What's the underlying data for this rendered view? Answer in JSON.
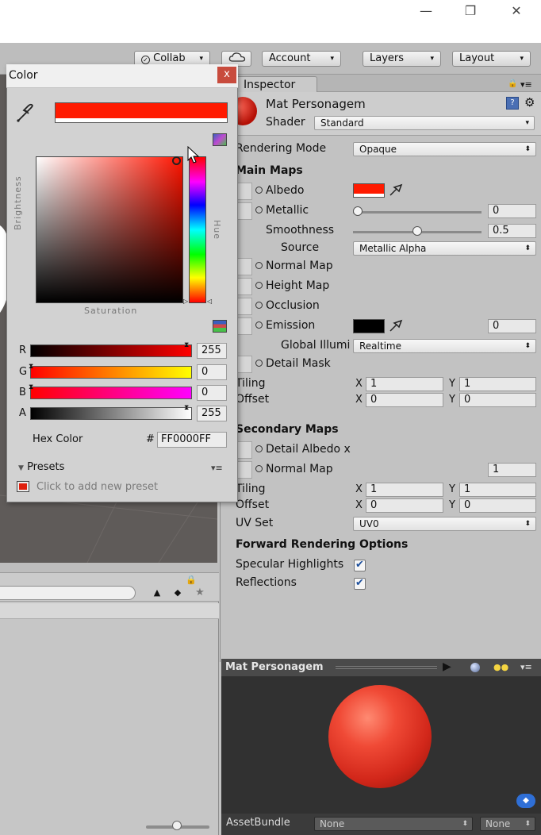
{
  "window": {
    "minimize": "—",
    "restore": "❐",
    "close": "✕"
  },
  "toolbar": {
    "collab": "Collab",
    "account": "Account",
    "layers": "Layers",
    "layout": "Layout",
    "dropdown_arrow": "▾"
  },
  "inspector": {
    "tab": "Inspector",
    "material_name": "Mat Personagem",
    "shader_label": "Shader",
    "shader_value": "Standard",
    "rendering_mode_label": "Rendering Mode",
    "rendering_mode_value": "Opaque",
    "main_maps": "Main Maps",
    "albedo": "Albedo",
    "metallic": "Metallic",
    "metallic_value": "0",
    "metallic_level": 0.0,
    "smoothness": "Smoothness",
    "smoothness_value": "0.5",
    "smoothness_level": 0.5,
    "source": "Source",
    "source_value": "Metallic Alpha",
    "normal_map": "Normal Map",
    "height_map": "Height Map",
    "occlusion": "Occlusion",
    "emission": "Emission",
    "emission_value": "0",
    "global_illum": "Global Illumi",
    "global_illum_value": "Realtime",
    "detail_mask": "Detail Mask",
    "tiling": "Tiling",
    "offset": "Offset",
    "x": "X",
    "y": "Y",
    "tiling_x": "1",
    "tiling_y": "1",
    "offset_x": "0",
    "offset_y": "0",
    "secondary_maps": "Secondary Maps",
    "detail_albedo": "Detail Albedo x",
    "secondary_normal": "Normal Map",
    "secondary_normal_value": "1",
    "tiling2_x": "1",
    "tiling2_y": "1",
    "offset2_x": "0",
    "offset2_y": "0",
    "uv_set": "UV Set",
    "uv_set_value": "UV0",
    "forward_opts": "Forward Rendering Options",
    "specular": "Specular Highlights",
    "reflections": "Reflections",
    "check": "✔",
    "albedo_color": "#ff1a00",
    "emission_color": "#000000"
  },
  "preview": {
    "title": "Mat Personagem",
    "assetbundle": "AssetBundle",
    "bundle_value": "None",
    "variant_value": "None"
  },
  "color_picker": {
    "title": "Color",
    "close": "x",
    "brightness": "Brightness",
    "saturation": "Saturation",
    "hue": "Hue",
    "r_label": "R",
    "r_value": "255",
    "g_label": "G",
    "g_value": "0",
    "b_label": "B",
    "b_value": "0",
    "a_label": "A",
    "a_value": "255",
    "hex_label": "Hex Color",
    "hash": "#",
    "hex_value": "FF0000FF",
    "presets": "Presets",
    "add_preset": "Click to add new preset",
    "current_color": "#ff1a00"
  }
}
